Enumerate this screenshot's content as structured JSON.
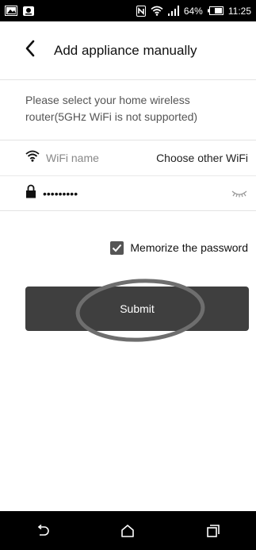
{
  "status_bar": {
    "battery_percent": "64%",
    "time": "11:25",
    "icons": [
      "image-icon",
      "notification-app-icon",
      "nfc-icon",
      "wifi-icon",
      "signal-icon",
      "battery-icon"
    ]
  },
  "header": {
    "back_icon": "chevron-left-icon",
    "title": "Add appliance manually"
  },
  "info": {
    "text": "Please select your home wireless router(5GHz WiFi is not supported)"
  },
  "wifi_row": {
    "icon": "wifi-icon",
    "placeholder": "WiFi name",
    "choose_label": "Choose other WiFi"
  },
  "password_row": {
    "icon": "lock-icon",
    "value": "•••••••••",
    "toggle_icon": "eye-closed-icon"
  },
  "memorize": {
    "checked": true,
    "label": "Memorize the password"
  },
  "submit": {
    "label": "Submit"
  },
  "nav_bar": {
    "icons": [
      "back-icon",
      "home-icon",
      "recents-icon"
    ]
  },
  "colors": {
    "button_bg": "#3f3f3f",
    "annotation_oval": "#6e6e6e",
    "system_bar": "#000000"
  }
}
